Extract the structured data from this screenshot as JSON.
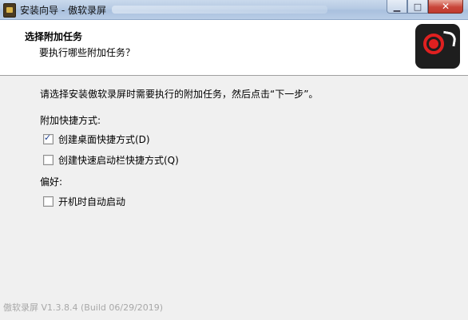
{
  "window": {
    "title": "安装向导 - 傲软录屏",
    "minimize_icon": "minimize-icon",
    "maximize_icon": "maximize-icon",
    "close_icon": "close-icon",
    "close_color": "#c9463a"
  },
  "header": {
    "title": "选择附加任务",
    "subtitle": "要执行哪些附加任务？",
    "logo_icon": "record-logo-icon",
    "logo_bg": "#1e1e1e",
    "logo_accent": "#e02020"
  },
  "content": {
    "instruction": "请选择安装傲软录屏时需要执行的附加任务，然后点击“下一步”。",
    "shortcut_group_label": "附加快捷方式:",
    "options": [
      {
        "label": "创建桌面快捷方式(D)",
        "checked": true
      },
      {
        "label": "创建快速启动栏快捷方式(Q)",
        "checked": false
      }
    ],
    "preference_group_label": "偏好:",
    "preferences": [
      {
        "label": "开机时自动启动",
        "checked": false
      }
    ]
  },
  "footer": {
    "version_text": "傲软录屏 V1.3.8.4 (Build 06/29/2019)"
  }
}
